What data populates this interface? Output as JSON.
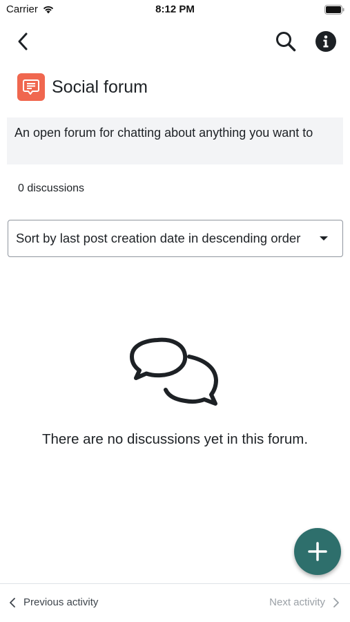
{
  "status_bar": {
    "carrier": "Carrier",
    "time": "8:12 PM"
  },
  "nav": {
    "back_icon": "chevron-left-icon",
    "search_icon": "search-icon",
    "info_icon": "info-icon"
  },
  "forum": {
    "icon": "forum-chat-icon",
    "icon_color": "#f0674f",
    "title": "Social forum",
    "description": "An open forum for chatting about anything you want to",
    "discussion_count": "0 discussions"
  },
  "sort": {
    "selected": "Sort by last post creation date in descending order"
  },
  "empty_state": {
    "icon": "chat-bubbles-icon",
    "message": "There are no discussions yet in this forum."
  },
  "fab": {
    "icon": "plus-icon",
    "color": "#2e6f6c"
  },
  "bottom_nav": {
    "previous_label": "Previous activity",
    "next_label": "Next activity"
  }
}
